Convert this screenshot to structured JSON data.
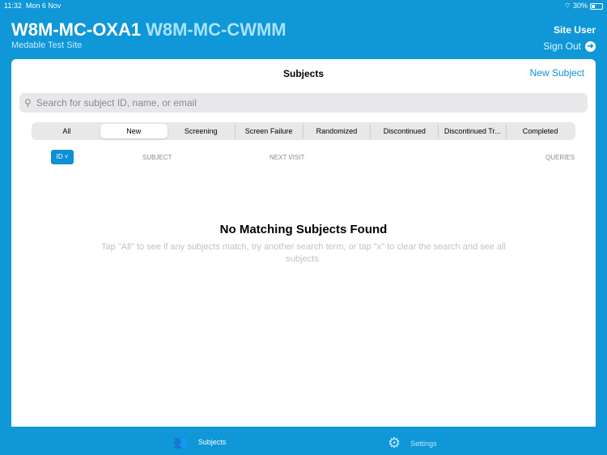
{
  "status": {
    "time": "11:32",
    "date": "Mon 6 Nov",
    "battery": "30%"
  },
  "header": {
    "title1": "W8M-MC-OXA1",
    "title2": "W8M-MC-CWMM",
    "site": "Medable Test Site",
    "user": "Site User",
    "sign_out": "Sign Out"
  },
  "main": {
    "title": "Subjects",
    "new_subject": "New Subject",
    "search_placeholder": "Search for subject ID, name, or email",
    "filters": [
      "All",
      "New",
      "Screening",
      "Screen Failure",
      "Randomized",
      "Discontinued",
      "Discontinued Tr...",
      "Completed"
    ],
    "sort": "ID ˅",
    "columns": [
      "SUBJECT",
      "NEXT VISIT",
      "QUERIES"
    ],
    "empty_title": "No Matching Subjects Found",
    "empty_message": "Tap \"All\" to see if any subjects match, try another search term, or tap \"x\" to clear the search and see all subjects."
  },
  "tabs": [
    {
      "label": "Subjects"
    },
    {
      "label": "Settings"
    }
  ]
}
